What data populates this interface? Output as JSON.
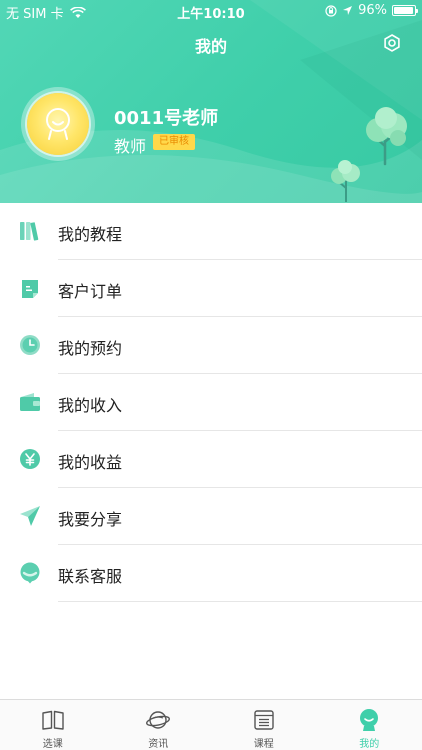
{
  "status_bar": {
    "carrier": "无 SIM 卡",
    "time": "上午10:10",
    "battery": "96%",
    "battery_level": 0.96
  },
  "header": {
    "title": "我的",
    "settings_icon": "settings-hexagon-icon"
  },
  "profile": {
    "name": "0011号老师",
    "role": "教师",
    "badge": "已审核",
    "avatar_icon": "smiley-avatar-icon"
  },
  "menu": {
    "items": [
      {
        "label": "我的教程",
        "icon": "books-icon"
      },
      {
        "label": "客户订单",
        "icon": "order-icon"
      },
      {
        "label": "我的预约",
        "icon": "clock-icon"
      },
      {
        "label": "我的收入",
        "icon": "wallet-icon"
      },
      {
        "label": "我的收益",
        "icon": "yen-icon"
      },
      {
        "label": "我要分享",
        "icon": "paper-plane-icon"
      },
      {
        "label": "联系客服",
        "icon": "chat-bubble-icon"
      }
    ]
  },
  "tabbar": {
    "tabs": [
      {
        "label": "选课",
        "icon": "book-open-icon",
        "active": false
      },
      {
        "label": "资讯",
        "icon": "planet-icon",
        "active": false
      },
      {
        "label": "课程",
        "icon": "list-icon",
        "active": false
      },
      {
        "label": "我的",
        "icon": "face-icon",
        "active": true
      }
    ]
  },
  "colors": {
    "accent": "#3fcfaa",
    "header_start": "#52d7b6",
    "badge_bg": "#ffd84a",
    "badge_text": "#e88a00"
  }
}
